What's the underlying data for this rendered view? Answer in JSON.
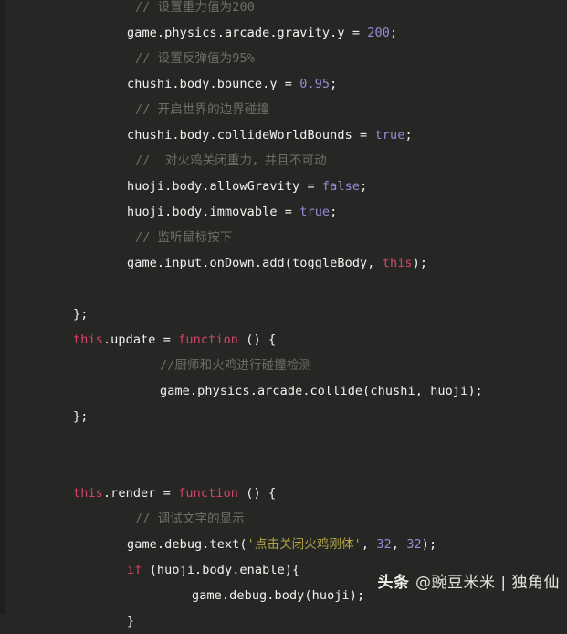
{
  "editor": {
    "language": "javascript",
    "theme_name": "dark",
    "background_color": "#262624",
    "foreground_color": "#f2f2f0",
    "comment_color": "#6e6e68",
    "keyword_color": "#d2466a",
    "number_color": "#9b8ad6",
    "string_color": "#b3a447"
  },
  "code": {
    "lines": [
      {
        "id": "l1",
        "indent": "cmt",
        "tokens": [
          {
            "t": "// 设置重力值为200",
            "c": "comment"
          }
        ]
      },
      {
        "id": "l2",
        "indent": "code",
        "tokens": [
          {
            "t": "game.physics.arcade.gravity.y = ",
            "c": "plain"
          },
          {
            "t": "200",
            "c": "num"
          },
          {
            "t": ";",
            "c": "plain"
          }
        ]
      },
      {
        "id": "l3",
        "indent": "cmt",
        "tokens": [
          {
            "t": "// 设置反弹值为95%",
            "c": "comment"
          }
        ]
      },
      {
        "id": "l4",
        "indent": "code",
        "tokens": [
          {
            "t": "chushi.body.bounce.y = ",
            "c": "plain"
          },
          {
            "t": "0.95",
            "c": "num"
          },
          {
            "t": ";",
            "c": "plain"
          }
        ]
      },
      {
        "id": "l5",
        "indent": "cmt",
        "tokens": [
          {
            "t": "// 开启世界的边界碰撞",
            "c": "comment"
          }
        ]
      },
      {
        "id": "l6",
        "indent": "code",
        "tokens": [
          {
            "t": "chushi.body.collideWorldBounds = ",
            "c": "plain"
          },
          {
            "t": "true",
            "c": "bool"
          },
          {
            "t": ";",
            "c": "plain"
          }
        ]
      },
      {
        "id": "l7",
        "indent": "cmt",
        "tokens": [
          {
            "t": "//  对火鸡关闭重力，并且不可动",
            "c": "comment"
          }
        ]
      },
      {
        "id": "l8",
        "indent": "code",
        "tokens": [
          {
            "t": "huoji.body.allowGravity = ",
            "c": "plain"
          },
          {
            "t": "false",
            "c": "bool"
          },
          {
            "t": ";",
            "c": "plain"
          }
        ]
      },
      {
        "id": "l9",
        "indent": "code",
        "tokens": [
          {
            "t": "huoji.body.immovable = ",
            "c": "plain"
          },
          {
            "t": "true",
            "c": "bool"
          },
          {
            "t": ";",
            "c": "plain"
          }
        ]
      },
      {
        "id": "l10",
        "indent": "cmt",
        "tokens": [
          {
            "t": "// 监听鼠标按下",
            "c": "comment"
          }
        ]
      },
      {
        "id": "l11",
        "indent": "code",
        "tokens": [
          {
            "t": "game.input.onDown.add(toggleBody, ",
            "c": "plain"
          },
          {
            "t": "this",
            "c": "kw"
          },
          {
            "t": ");",
            "c": "plain"
          }
        ]
      },
      {
        "id": "l12",
        "indent": "code",
        "tokens": []
      },
      {
        "id": "l13",
        "indent": "brace",
        "tokens": [
          {
            "t": "};",
            "c": "plain"
          }
        ]
      },
      {
        "id": "l14",
        "indent": "top",
        "tokens": [
          {
            "t": "this",
            "c": "kw"
          },
          {
            "t": ".update = ",
            "c": "plain"
          },
          {
            "t": "function",
            "c": "kw"
          },
          {
            "t": " () {",
            "c": "plain"
          }
        ]
      },
      {
        "id": "l15",
        "indent": "deep",
        "tokens": [
          {
            "t": "//厨师和火鸡进行碰撞检测",
            "c": "comment"
          }
        ]
      },
      {
        "id": "l16",
        "indent": "deep",
        "tokens": [
          {
            "t": "game.physics.arcade.collide(chushi, huoji);",
            "c": "plain"
          }
        ]
      },
      {
        "id": "l17",
        "indent": "brace",
        "tokens": [
          {
            "t": "};",
            "c": "plain"
          }
        ]
      },
      {
        "id": "l18",
        "indent": "code",
        "tokens": []
      },
      {
        "id": "l19",
        "indent": "code",
        "tokens": []
      },
      {
        "id": "l20",
        "indent": "top",
        "tokens": [
          {
            "t": "this",
            "c": "kw"
          },
          {
            "t": ".render = ",
            "c": "plain"
          },
          {
            "t": "function",
            "c": "kw"
          },
          {
            "t": " () {",
            "c": "plain"
          }
        ]
      },
      {
        "id": "l21",
        "indent": "cmt",
        "tokens": [
          {
            "t": "// 调试文字的显示",
            "c": "comment"
          }
        ]
      },
      {
        "id": "l22",
        "indent": "code",
        "tokens": [
          {
            "t": "game.debug.text(",
            "c": "plain"
          },
          {
            "t": "'点击关闭火鸡刚体'",
            "c": "str"
          },
          {
            "t": ", ",
            "c": "plain"
          },
          {
            "t": "32",
            "c": "num"
          },
          {
            "t": ", ",
            "c": "plain"
          },
          {
            "t": "32",
            "c": "num"
          },
          {
            "t": ");",
            "c": "plain"
          }
        ]
      },
      {
        "id": "l23",
        "indent": "code",
        "tokens": [
          {
            "t": "if",
            "c": "kw"
          },
          {
            "t": " (huoji.body.enable){",
            "c": "plain"
          }
        ]
      },
      {
        "id": "l24",
        "indent": "deep2",
        "tokens": [
          {
            "t": "game.debug.body(huoji);",
            "c": "plain"
          }
        ]
      },
      {
        "id": "l25",
        "indent": "code",
        "tokens": [
          {
            "t": "}",
            "c": "plain"
          }
        ]
      }
    ]
  },
  "watermark": {
    "brand": "头条 ",
    "handle": "@豌豆米米 | 独角仙"
  }
}
